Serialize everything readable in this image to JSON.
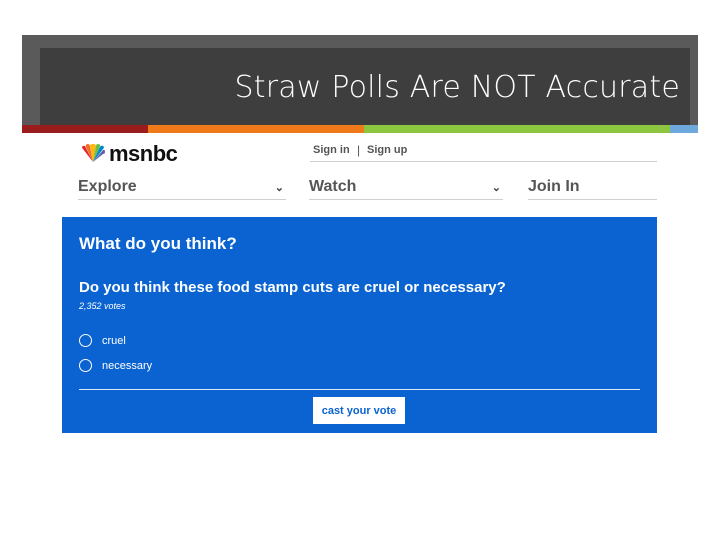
{
  "slide": {
    "title": "Straw Polls Are NOT Accurate",
    "stripe_colors": [
      "#9b1c1c",
      "#f07a1a",
      "#8cc63f",
      "#6fa8dc"
    ]
  },
  "site": {
    "logo_text": "msnbc",
    "logo_icon": "peacock-icon",
    "sign_in": "Sign in",
    "separator": "|",
    "sign_up": "Sign up"
  },
  "nav": {
    "explore": "Explore",
    "watch": "Watch",
    "join": "Join In",
    "dropdown_icon": "chevron-down-icon"
  },
  "poll": {
    "heading": "What do you think?",
    "question": "Do you think these food stamp cuts are cruel or necessary?",
    "votes": "2,352 votes",
    "options": [
      {
        "label": "cruel"
      },
      {
        "label": "necessary"
      }
    ],
    "submit": "cast your vote",
    "background_color": "#0a63d1"
  }
}
